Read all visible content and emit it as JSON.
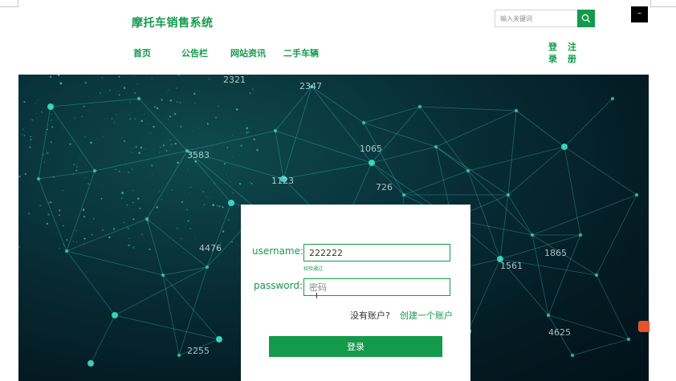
{
  "header": {
    "site_title": "摩托车销售系统",
    "search": {
      "placeholder": "输入关键词",
      "icon": "search-icon"
    },
    "window_button": "–"
  },
  "nav": {
    "items": [
      {
        "label": "首页"
      },
      {
        "label": "公告栏"
      },
      {
        "label": "网站资讯"
      },
      {
        "label": "二手车辆"
      }
    ]
  },
  "auth": {
    "login": "登录",
    "register": "注册"
  },
  "hero": {
    "numbers": [
      "2347",
      "2321",
      "3583",
      "1065",
      "1123",
      "726",
      "4476",
      "1865",
      "1561",
      "4625",
      "2255"
    ]
  },
  "login_form": {
    "username_label": "username:",
    "username_value": "222222",
    "username_hint": "校验通过",
    "password_label": "password:",
    "password_placeholder": "密码",
    "no_account_text": "没有账户?",
    "create_account_link": "创建一个账户",
    "submit_label": "登录"
  },
  "colors": {
    "accent": "#149a4b",
    "hero_bg": "#062833",
    "hero_node": "#3fe0d0"
  }
}
